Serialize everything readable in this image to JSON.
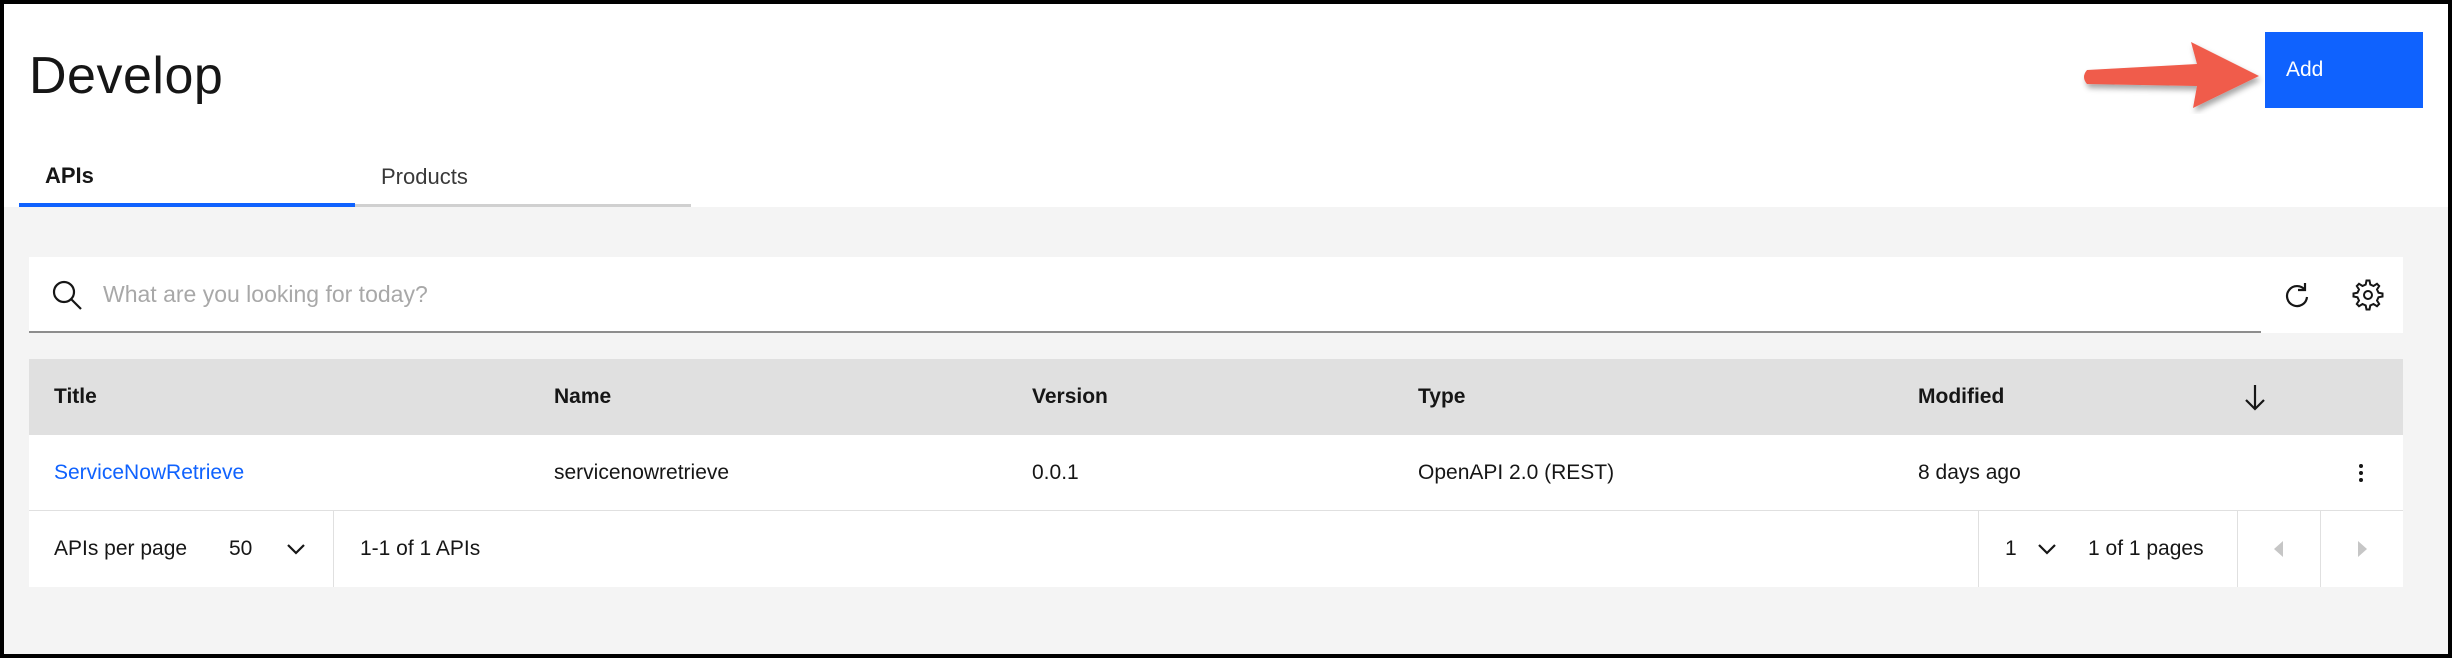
{
  "header": {
    "title": "Develop",
    "add_label": "Add"
  },
  "tabs": [
    {
      "label": "APIs",
      "selected": true
    },
    {
      "label": "Products",
      "selected": false
    }
  ],
  "search": {
    "placeholder": "What are you looking for today?",
    "value": ""
  },
  "table": {
    "columns": [
      "Title",
      "Name",
      "Version",
      "Type",
      "Modified"
    ],
    "rows": [
      {
        "title": "ServiceNowRetrieve",
        "name": "servicenowretrieve",
        "version": "0.0.1",
        "type": "OpenAPI 2.0 (REST)",
        "modified": "8 days ago"
      }
    ]
  },
  "pagination": {
    "per_page_label": "APIs per page",
    "per_page_value": "50",
    "range_text": "1-1 of 1 APIs",
    "page_value": "1",
    "pages_text": "1 of 1 pages"
  },
  "colors": {
    "accent": "#0f62fe",
    "annotation_arrow": "#f05b4b"
  },
  "icons": [
    "search-icon",
    "refresh-icon",
    "settings-icon",
    "arrow-down-icon",
    "overflow-menu-icon",
    "chevron-down-icon",
    "caret-left-icon",
    "caret-right-icon"
  ]
}
